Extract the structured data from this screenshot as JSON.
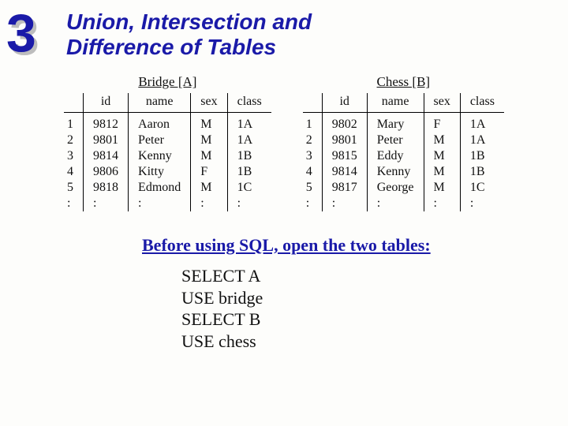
{
  "slide_number": "3",
  "title_line1": "Union, Intersection and",
  "title_line2": "Difference of Tables",
  "tables": {
    "left": {
      "caption": "Bridge [A]",
      "headers": {
        "id": "id",
        "name": "name",
        "sex": "sex",
        "class": "class"
      },
      "rows": [
        {
          "n": "1",
          "id": "9812",
          "name": "Aaron",
          "sex": "M",
          "class": "1A"
        },
        {
          "n": "2",
          "id": "9801",
          "name": "Peter",
          "sex": "M",
          "class": "1A"
        },
        {
          "n": "3",
          "id": "9814",
          "name": "Kenny",
          "sex": "M",
          "class": "1B"
        },
        {
          "n": "4",
          "id": "9806",
          "name": "Kitty",
          "sex": "F",
          "class": "1B"
        },
        {
          "n": "5",
          "id": "9818",
          "name": "Edmond",
          "sex": "M",
          "class": "1C"
        },
        {
          "n": ":",
          "id": ":",
          "name": ":",
          "sex": ":",
          "class": ":"
        }
      ]
    },
    "right": {
      "caption": "Chess [B]",
      "headers": {
        "id": "id",
        "name": "name",
        "sex": "sex",
        "class": "class"
      },
      "rows": [
        {
          "n": "1",
          "id": "9802",
          "name": "Mary",
          "sex": "F",
          "class": "1A"
        },
        {
          "n": "2",
          "id": "9801",
          "name": "Peter",
          "sex": "M",
          "class": "1A"
        },
        {
          "n": "3",
          "id": "9815",
          "name": "Eddy",
          "sex": "M",
          "class": "1B"
        },
        {
          "n": "4",
          "id": "9814",
          "name": "Kenny",
          "sex": "M",
          "class": "1B"
        },
        {
          "n": "5",
          "id": "9817",
          "name": "George",
          "sex": "M",
          "class": "1C"
        },
        {
          "n": ":",
          "id": ":",
          "name": ":",
          "sex": ":",
          "class": ":"
        }
      ]
    }
  },
  "instruction": "Before using SQL, open the two tables:",
  "code": {
    "l1": "SELECT A",
    "l2": "USE bridge",
    "l3": "SELECT B",
    "l4": "USE chess"
  }
}
